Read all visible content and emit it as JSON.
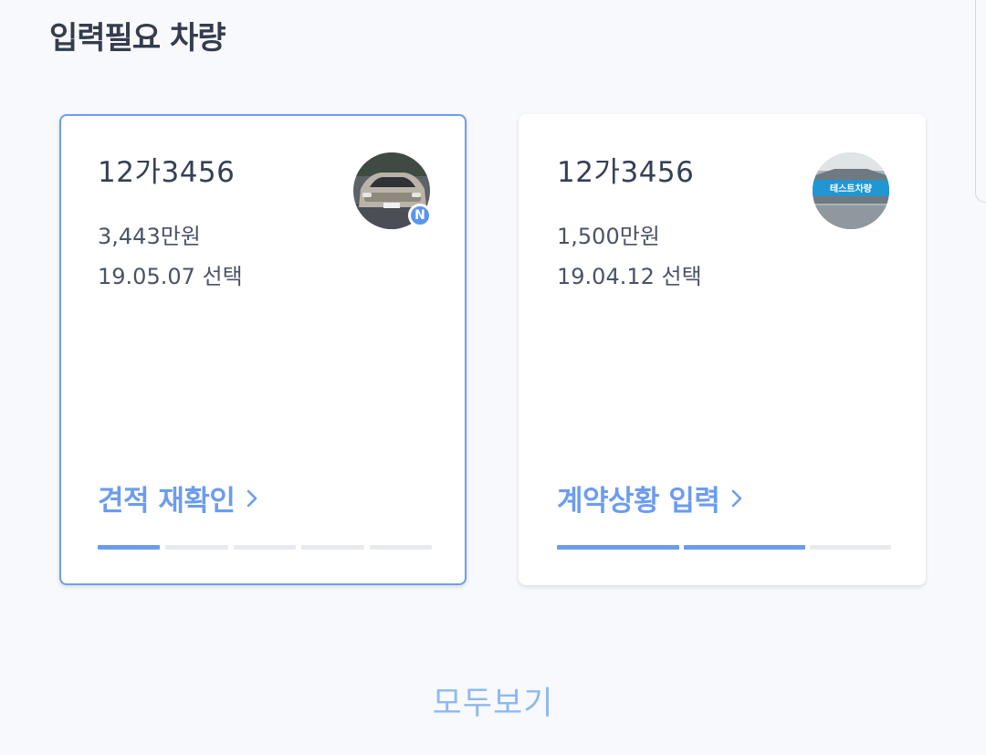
{
  "section": {
    "title": "입력필요 차량"
  },
  "cards": [
    {
      "plate": "12가3456",
      "price": "3,443만원",
      "date": "19.05.07 선택",
      "badge": "N",
      "thumb_icon": "car-photo-icon",
      "action_label": "견적 재확인",
      "progress": {
        "steps": 5,
        "completed": 1
      }
    },
    {
      "plate": "12가3456",
      "price": "1,500만원",
      "date": "19.04.12 선택",
      "thumb_label": "테스트차량",
      "thumb_icon": "car-photo-icon",
      "action_label": "계약상황 입력",
      "progress": {
        "steps": 3,
        "completed": 2
      }
    }
  ],
  "footer": {
    "see_all": "모두보기"
  },
  "colors": {
    "accent": "#6c9cf0",
    "active_border": "#6d9ef2",
    "badge": "#5b95f0",
    "tag": "#2196d3"
  }
}
